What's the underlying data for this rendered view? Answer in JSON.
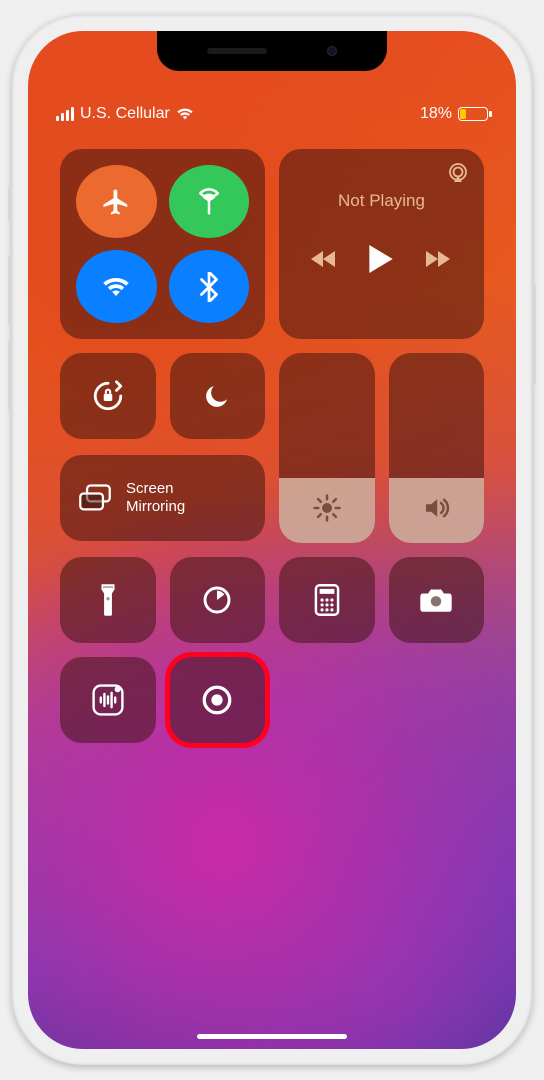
{
  "status": {
    "carrier": "U.S. Cellular",
    "battery_pct": "18%"
  },
  "media": {
    "now_playing": "Not Playing"
  },
  "mirroring": {
    "label": "Screen\nMirroring"
  },
  "sliders": {
    "brightness_pct": 34,
    "volume_pct": 34
  },
  "icons": {
    "airplane": "airplane-icon",
    "cellular": "cellular-antenna-icon",
    "wifi": "wifi-icon",
    "bluetooth": "bluetooth-icon",
    "airplay": "airplay-icon",
    "prev": "previous-track-icon",
    "play": "play-icon",
    "next": "next-track-icon",
    "orientation_lock": "orientation-lock-icon",
    "dnd": "do-not-disturb-icon",
    "mirror": "screen-mirroring-icon",
    "brightness": "brightness-icon",
    "volume": "volume-icon",
    "flashlight": "flashlight-icon",
    "timer": "timer-icon",
    "calculator": "calculator-icon",
    "camera": "camera-icon",
    "voice_memos": "voice-memos-icon",
    "screen_record": "screen-record-icon"
  }
}
